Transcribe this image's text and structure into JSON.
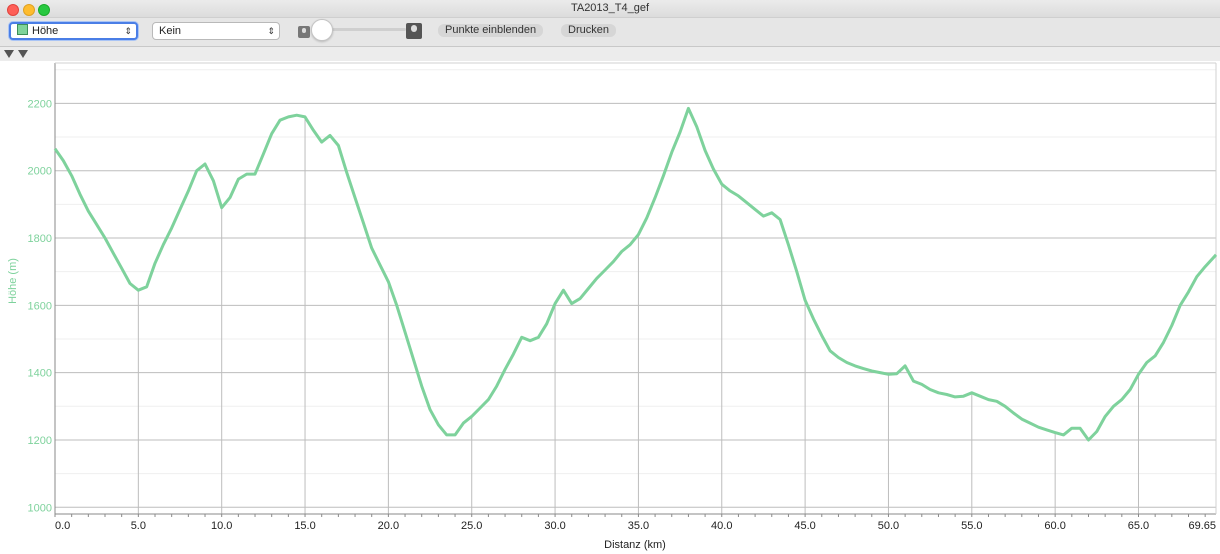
{
  "window": {
    "title": "TA2013_T4_gef"
  },
  "toolbar": {
    "series_select": "Höhe",
    "second_select": "Kein",
    "show_points_label": "Punkte einblenden",
    "print_label": "Drucken"
  },
  "chart_data": {
    "type": "line",
    "xlabel": "Distanz (km)",
    "ylabel": "Höhe (m)",
    "xlim": [
      0,
      69.65
    ],
    "ylim": [
      980,
      2320
    ],
    "x_ticks": [
      "0.0",
      "5.0",
      "10.0",
      "15.0",
      "20.0",
      "25.0",
      "30.0",
      "35.0",
      "40.0",
      "45.0",
      "50.0",
      "55.0",
      "60.0",
      "65.0",
      "69.65"
    ],
    "y_ticks": [
      "1000",
      "1200",
      "1400",
      "1600",
      "1800",
      "2000",
      "2200"
    ],
    "grid": true,
    "line_color": "#7ed29c",
    "series": [
      {
        "x": [
          0,
          0.5,
          1,
          1.5,
          2,
          2.5,
          3,
          3.5,
          4,
          4.5,
          5,
          5.5,
          6,
          6.5,
          7,
          7.5,
          8,
          8.5,
          9,
          9.5,
          10,
          10.5,
          11,
          11.5,
          12,
          12.5,
          13,
          13.5,
          14,
          14.5,
          15,
          15.5,
          16,
          16.5,
          17,
          17.5,
          18,
          18.5,
          19,
          19.5,
          20,
          20.5,
          21,
          21.5,
          22,
          22.5,
          23,
          23.5,
          24,
          24.5,
          25,
          25.5,
          26,
          26.5,
          27,
          27.5,
          28,
          28.5,
          29,
          29.5,
          30,
          30.5,
          31,
          31.5,
          32,
          32.5,
          33,
          33.5,
          34,
          34.5,
          35,
          35.5,
          36,
          36.5,
          37,
          37.5,
          38,
          38.5,
          39,
          39.5,
          40,
          40.5,
          41,
          41.5,
          42,
          42.5,
          43,
          43.5,
          44,
          44.5,
          45,
          45.5,
          46,
          46.5,
          47,
          47.5,
          48,
          48.5,
          49,
          49.5,
          50,
          50.5,
          51,
          51.5,
          52,
          52.5,
          53,
          53.5,
          54,
          54.5,
          55,
          55.5,
          56,
          56.5,
          57,
          57.5,
          58,
          58.5,
          59,
          59.5,
          60,
          60.5,
          61,
          61.5,
          62,
          62.5,
          63,
          63.5,
          64,
          64.5,
          65,
          65.5,
          66,
          66.5,
          67,
          67.5,
          68,
          68.5,
          69,
          69.65
        ],
        "y": [
          2065,
          2030,
          1985,
          1930,
          1880,
          1840,
          1800,
          1755,
          1710,
          1665,
          1645,
          1655,
          1725,
          1780,
          1830,
          1885,
          1940,
          2000,
          2020,
          1970,
          1890,
          1920,
          1975,
          1990,
          1990,
          2050,
          2110,
          2150,
          2160,
          2165,
          2160,
          2120,
          2085,
          2105,
          2075,
          1995,
          1920,
          1845,
          1770,
          1720,
          1670,
          1600,
          1520,
          1440,
          1360,
          1290,
          1245,
          1215,
          1215,
          1250,
          1270,
          1295,
          1320,
          1360,
          1410,
          1455,
          1505,
          1495,
          1505,
          1545,
          1605,
          1645,
          1605,
          1620,
          1650,
          1680,
          1705,
          1730,
          1760,
          1780,
          1810,
          1860,
          1920,
          1985,
          2055,
          2115,
          2185,
          2130,
          2060,
          2005,
          1960,
          1940,
          1925,
          1905,
          1885,
          1865,
          1875,
          1855,
          1780,
          1700,
          1615,
          1560,
          1510,
          1465,
          1445,
          1430,
          1420,
          1412,
          1405,
          1400,
          1395,
          1397,
          1420,
          1375,
          1365,
          1350,
          1340,
          1335,
          1328,
          1330,
          1340,
          1330,
          1320,
          1315,
          1300,
          1280,
          1262,
          1250,
          1238,
          1230,
          1222,
          1215,
          1235,
          1235,
          1200,
          1225,
          1270,
          1300,
          1320,
          1350,
          1395,
          1430,
          1450,
          1490,
          1540,
          1600,
          1640,
          1685,
          1715,
          1750
        ]
      }
    ]
  }
}
